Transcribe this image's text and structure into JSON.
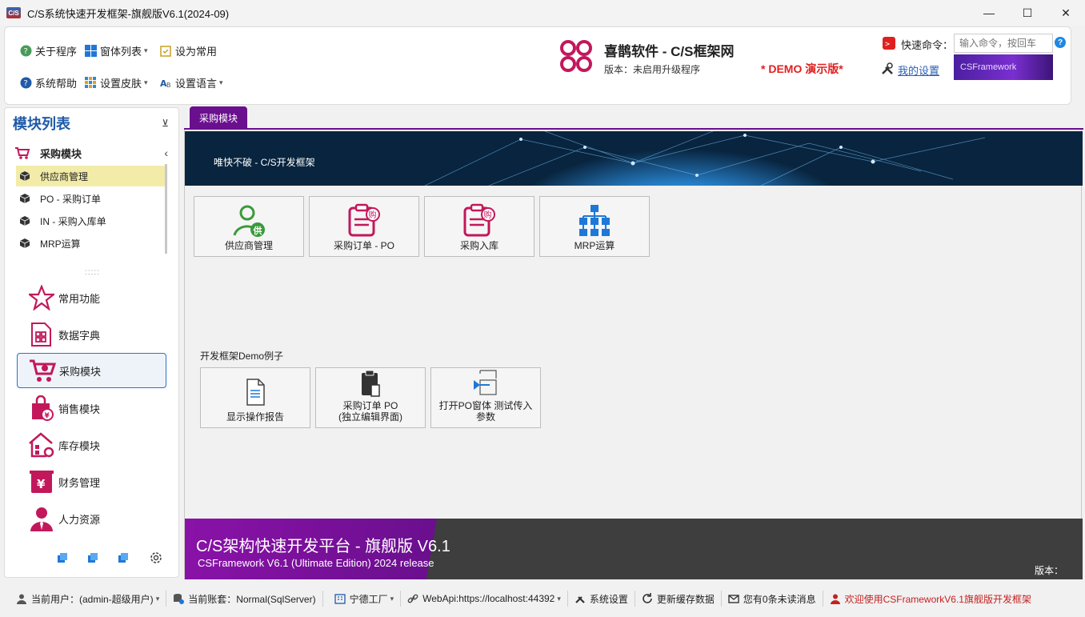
{
  "window": {
    "title": "C/S系统快速开发框架-旗舰版V6.1(2024-09)",
    "logo_text": "C/S"
  },
  "ribbon": {
    "about": "关于程序",
    "window_list": "窗体列表",
    "set_common": "设为常用",
    "help": "系统帮助",
    "skin": "设置皮肤",
    "language": "设置语言",
    "brand_title": "喜鹊软件 - C/S框架网",
    "version_text": "版本：未启用升级程序",
    "demo": "* DEMO 演示版*",
    "quick_command_label": "快速命令：",
    "quick_command_placeholder": "输入命令，按回车",
    "my_settings": "我的设置",
    "cs_banner": "CSFramework"
  },
  "left_panel": {
    "title": "模块列表",
    "group_title": "采购模块",
    "sub_items": [
      {
        "label": "供应商管理"
      },
      {
        "label": "PO - 采购订单"
      },
      {
        "label": "IN - 采购入库单"
      },
      {
        "label": "MRP运算"
      }
    ],
    "nav_items": [
      {
        "label": "常用功能"
      },
      {
        "label": "数据字典"
      },
      {
        "label": "采购模块"
      },
      {
        "label": "销售模块"
      },
      {
        "label": "库存模块"
      },
      {
        "label": "财务管理"
      },
      {
        "label": "人力资源"
      }
    ]
  },
  "tab": {
    "label": "采购模块"
  },
  "content": {
    "banner_text": "唯快不破 - C/S开发框架",
    "tiles": [
      {
        "label": "供应商管理",
        "icon": "supplier-icon"
      },
      {
        "label": "采购订单 - PO",
        "icon": "purchase-order-icon"
      },
      {
        "label": "采购入库",
        "icon": "purchase-in-icon"
      },
      {
        "label": "MRP运算",
        "icon": "mrp-icon"
      }
    ],
    "section_label": "开发框架Demo例子",
    "demo_tiles": [
      {
        "line1": "显示操作报告",
        "line2": ""
      },
      {
        "line1": "采购订单 PO",
        "line2": "(独立编辑界面)"
      },
      {
        "line1": "打开PO窗体  测试传入",
        "line2": "参数"
      }
    ],
    "footer_title": "C/S架构快速开发平台 - 旗舰版 V6.1",
    "footer_sub": "CSFramework V6.1 (Ultimate Edition) 2024 release",
    "footer_version": "版本："
  },
  "status_bar": {
    "user": "当前用户：(admin-超级用户)",
    "account": "当前账套：Normal(SqlServer)",
    "factory": "宁德工厂",
    "webapi": "WebApi:https://localhost:44392",
    "settings": "系统设置",
    "refresh": "更新缓存数据",
    "messages": "您有0条未读消息",
    "welcome": "欢迎使用CSFrameworkV6.1旗舰版开发框架"
  },
  "colors": {
    "accent_purple": "#6a0f8e",
    "link_blue": "#2a5fb0",
    "demo_red": "#e02020",
    "brand_pink": "#c2185b"
  }
}
